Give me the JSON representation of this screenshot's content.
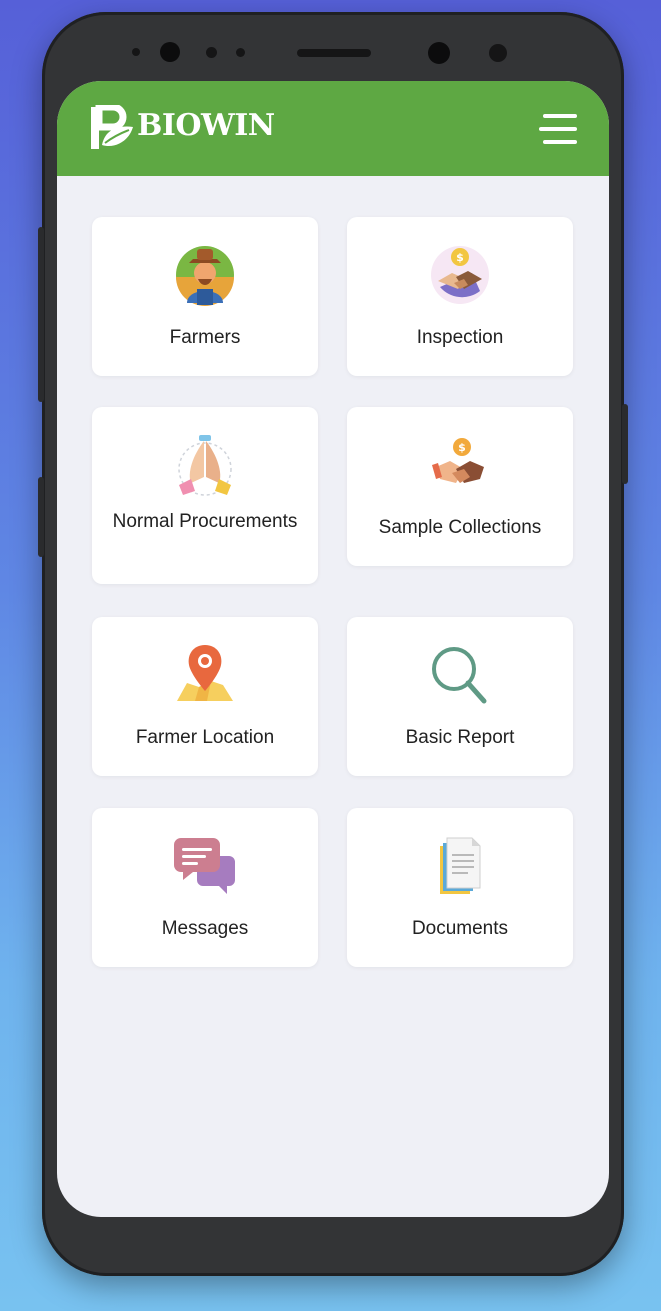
{
  "app": {
    "brand": "BIOWIN",
    "brand_color": "#5ea843",
    "background_color": "#eff0f6",
    "menu_icon": "hamburger-menu-icon"
  },
  "dashboard": {
    "tiles": [
      {
        "label": "Farmers",
        "icon": "farmer-icon"
      },
      {
        "label": "Inspection",
        "icon": "handshake-coin-icon"
      },
      {
        "label": "Normal Procurements",
        "icon": "praying-hands-icon"
      },
      {
        "label": "Sample Collections",
        "icon": "handshake-coin-icon"
      },
      {
        "label": "Farmer Location",
        "icon": "map-pin-icon"
      },
      {
        "label": "Basic Report",
        "icon": "magnifier-icon"
      },
      {
        "label": "Messages",
        "icon": "chat-bubbles-icon"
      },
      {
        "label": "Documents",
        "icon": "documents-icon"
      }
    ]
  }
}
